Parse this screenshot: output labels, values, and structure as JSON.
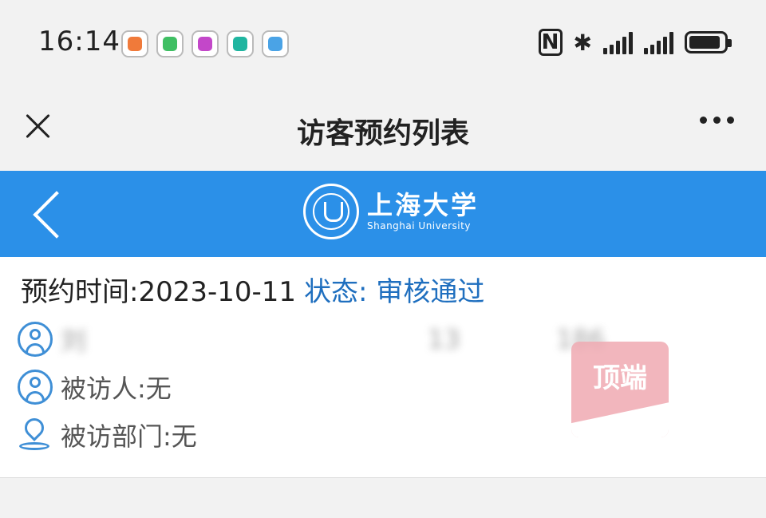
{
  "status_bar": {
    "time": "16:14",
    "app_icons": [
      {
        "name": "huawei-app-icon",
        "color": "#f07a3a"
      },
      {
        "name": "video-app-icon",
        "color": "#3fbf63"
      },
      {
        "name": "music-app-icon",
        "color": "#c347c9"
      },
      {
        "name": "mi-home-app-icon",
        "color": "#1fb5a0"
      },
      {
        "name": "message-app-icon",
        "color": "#4aa3e6"
      }
    ],
    "nfc_label": "N",
    "bluetooth_glyph": "✱"
  },
  "title_bar": {
    "title": "访客预约列表"
  },
  "header": {
    "logo_cn": "上海大学",
    "logo_en": "Shanghai University",
    "background": "#2b90e8"
  },
  "card": {
    "time_label": "预约时间:",
    "time_value": "2023-10-11",
    "status_label": "状态:",
    "status_value": "审核通过",
    "visitor_name": "刘",
    "visitor_phone": "13",
    "visitor_phone_tail": "186",
    "visitee": "被访人:无",
    "department": "被访部门:无"
  },
  "watermark": {
    "text": "顶端"
  }
}
